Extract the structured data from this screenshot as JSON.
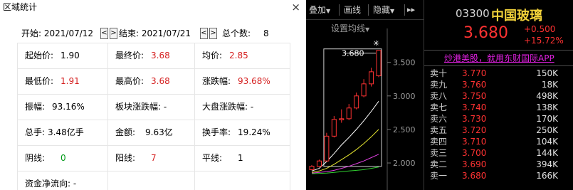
{
  "dialog": {
    "title": "区域统计",
    "close_icon": "×",
    "start_label": "开始: 2021/07/12",
    "end_label": "结束: 2021/07/21",
    "count_label": "总个数:",
    "count_value": "8",
    "prev_glyph": "<",
    "next_glyph": ">",
    "cells": {
      "open_label": "起始价:",
      "open_value": "1.90",
      "close_label": "最终价:",
      "close_value": "3.68",
      "avg_label": "均价:",
      "avg_value": "2.85",
      "low_label": "最低价:",
      "low_value": "1.91",
      "high_label": "最高价:",
      "high_value": "3.68",
      "rise_label": "涨跌幅:",
      "rise_value": "93.68%",
      "amp_label": "振幅:",
      "amp_value": "93.16%",
      "sector_label": "板块涨跌幅: -",
      "market_label": "大盘涨跌幅: -",
      "vol_label": "总手:",
      "vol_value": "3.48亿手",
      "amount_label": "金额:",
      "amount_value": "9.63亿",
      "turnover_label": "换手率:",
      "turnover_value": "19.24%",
      "neg_label": "阴线:",
      "neg_value": "0",
      "pos_label": "阳线:",
      "pos_value": "7",
      "flat_label": "平线:",
      "flat_value": "1",
      "flow_label": "资金净流向: -"
    }
  },
  "chart_toolbar": {
    "overlay": "叠加",
    "overlay_arrow": "▼",
    "draw": "画线",
    "hide": "隐藏",
    "hide_arrow": "▼",
    "fast_forward": "▸▸",
    "settings_label": "设置均线",
    "settings_arrow": "▼"
  },
  "chart_data": {
    "type": "candlestick",
    "y_ticks": [
      "3.500",
      "3.000",
      "2.500",
      "2.000"
    ],
    "y_tick_values": [
      3.5,
      3.0,
      2.5,
      2.0
    ],
    "ylim": [
      1.65,
      3.9
    ],
    "high_annotation": "3.680",
    "candles": [
      {
        "o": 1.9,
        "h": 1.97,
        "l": 1.89,
        "c": 1.95
      },
      {
        "o": 1.95,
        "h": 2.05,
        "l": 1.94,
        "c": 2.03
      },
      {
        "o": 2.03,
        "h": 2.45,
        "l": 2.02,
        "c": 2.4
      },
      {
        "o": 2.4,
        "h": 2.7,
        "l": 2.38,
        "c": 2.65
      },
      {
        "o": 2.66,
        "h": 2.8,
        "l": 2.6,
        "c": 2.66
      },
      {
        "o": 2.66,
        "h": 2.88,
        "l": 2.64,
        "c": 2.82
      },
      {
        "o": 2.82,
        "h": 3.05,
        "l": 2.8,
        "c": 3.0
      },
      {
        "o": 3.0,
        "h": 3.25,
        "l": 2.98,
        "c": 3.18
      },
      {
        "o": 3.18,
        "h": 3.42,
        "l": 3.14,
        "c": 3.36
      },
      {
        "o": 3.3,
        "h": 3.68,
        "l": 3.28,
        "c": 3.68
      }
    ],
    "ma_lines": [
      {
        "color": "#ffffff",
        "values": [
          1.88,
          1.92,
          2.02,
          2.14,
          2.27,
          2.38,
          2.5,
          2.63,
          2.77,
          2.92
        ]
      },
      {
        "color": "#e8e830",
        "values": [
          1.86,
          1.88,
          1.92,
          1.98,
          2.05,
          2.12,
          2.2,
          2.29,
          2.39,
          2.5
        ]
      },
      {
        "color": "#e040e0",
        "values": [
          1.85,
          1.86,
          1.87,
          1.89,
          1.92,
          1.95,
          1.99,
          2.03,
          2.08,
          2.13
        ]
      },
      {
        "color": "#30d030",
        "values": [
          1.84,
          1.845,
          1.85,
          1.86,
          1.87,
          1.88,
          1.89,
          1.9,
          1.92,
          1.94
        ]
      }
    ]
  },
  "quote": {
    "code": "03300",
    "name": "中国玻璃",
    "price": "3.680",
    "change": "+0.500",
    "change_pct": "+15.72%",
    "ad_text": "炒港美股，就用东财国际APP",
    "orders": [
      {
        "label": "卖十",
        "price": "3.770",
        "volume": "150K"
      },
      {
        "label": "卖九",
        "price": "3.760",
        "volume": "18K"
      },
      {
        "label": "卖八",
        "price": "3.750",
        "volume": "498K"
      },
      {
        "label": "卖七",
        "price": "3.740",
        "volume": "138K"
      },
      {
        "label": "卖六",
        "price": "3.730",
        "volume": "170K"
      },
      {
        "label": "卖五",
        "price": "3.720",
        "volume": "250K"
      },
      {
        "label": "卖四",
        "price": "3.710",
        "volume": "104K"
      },
      {
        "label": "卖三",
        "price": "3.700",
        "volume": "144K"
      },
      {
        "label": "卖二",
        "price": "3.690",
        "volume": "394K"
      },
      {
        "label": "卖一",
        "price": "3.680",
        "volume": "166K"
      }
    ],
    "colors": {
      "up": "#ff3232",
      "name": "#f2d23a",
      "ad": "#e020e0"
    }
  }
}
